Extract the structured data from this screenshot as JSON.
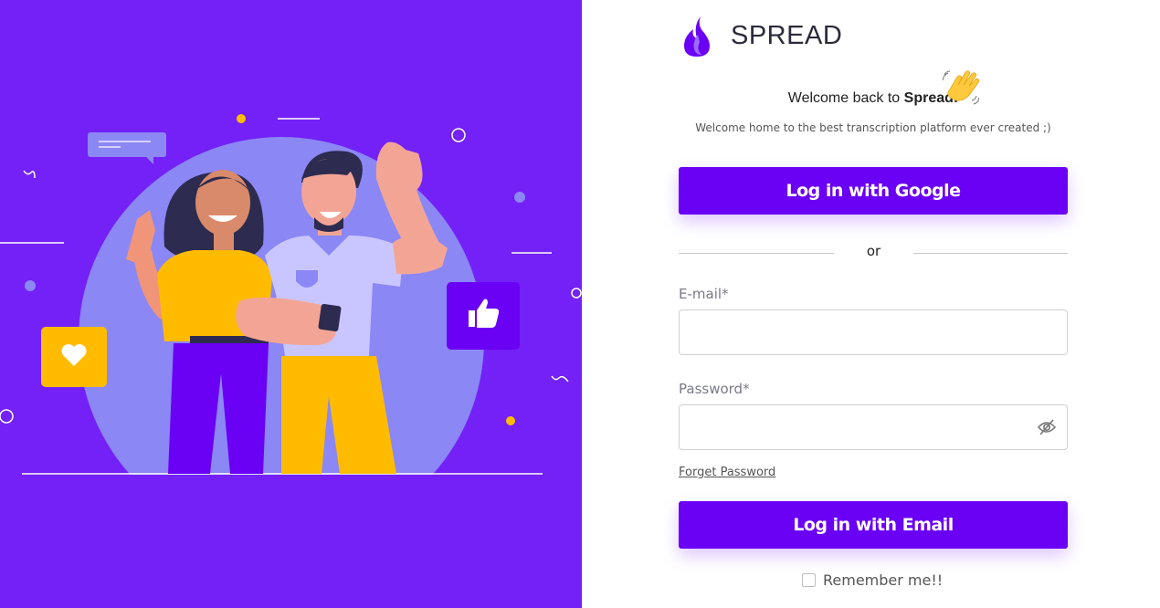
{
  "brand": {
    "name": "SPREAD"
  },
  "welcome": {
    "prefix": "Welcome back to ",
    "brand": "Spread!",
    "emoji": "waving-hand"
  },
  "subtitle": "Welcome home to the best transcription platform ever created ;)",
  "google_button": {
    "label": "Log in with Google"
  },
  "divider": {
    "text": "or"
  },
  "email": {
    "label": "E-mail*",
    "value": "",
    "placeholder": ""
  },
  "password": {
    "label": "Password*",
    "value": "",
    "placeholder": ""
  },
  "forget_password": {
    "label": "Forget Password"
  },
  "email_button": {
    "label": "Log in with Email"
  },
  "remember": {
    "label": "Remember me!!",
    "checked": false
  },
  "colors": {
    "brand_purple": "#6a00f4",
    "panel_purple": "#7321f6",
    "accent_yellow": "#ffbb00",
    "circle_lavender": "#8b87f5"
  },
  "icons": [
    "flame-logo-icon",
    "waving-hand-icon",
    "eye-slash-icon",
    "heart-icon",
    "thumbs-up-icon",
    "chat-bubble-icon"
  ]
}
